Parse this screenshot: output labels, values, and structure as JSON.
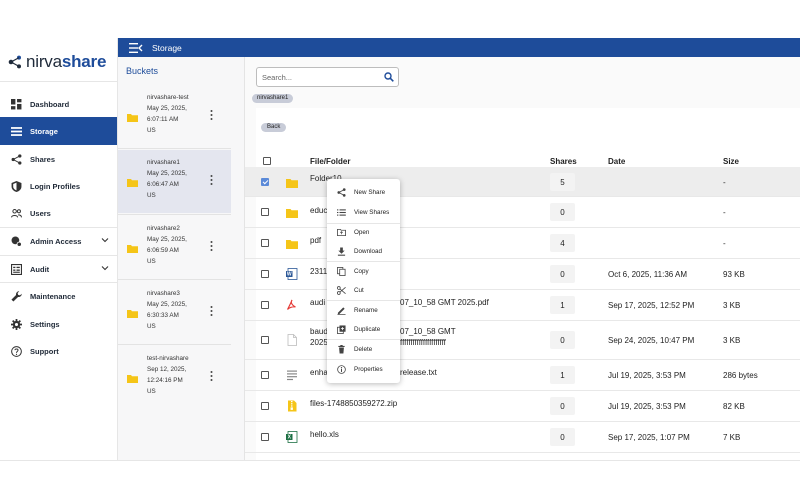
{
  "brand": {
    "logo_prefix": "nirva",
    "logo_suffix": "share"
  },
  "sidebar": {
    "items": [
      {
        "label": "Dashboard",
        "icon": "dashboard-icon"
      },
      {
        "label": "Storage",
        "icon": "storage-icon",
        "active": true
      },
      {
        "label": "Shares",
        "icon": "share-icon"
      },
      {
        "label": "Login Profiles",
        "icon": "shield-icon"
      },
      {
        "label": "Users",
        "icon": "users-icon"
      },
      {
        "label": "Admin Access",
        "icon": "admin-icon",
        "expandable": true
      },
      {
        "label": "Audit",
        "icon": "audit-icon",
        "expandable": true
      },
      {
        "label": "Maintenance",
        "icon": "wrench-icon"
      },
      {
        "label": "Settings",
        "icon": "gear-icon"
      },
      {
        "label": "Support",
        "icon": "help-icon"
      }
    ]
  },
  "topbar": {
    "title": "Storage"
  },
  "buckets": {
    "title": "Buckets",
    "items": [
      {
        "name": "nirvashare-test",
        "date": "May 25, 2025,",
        "time": "6:07:11 AM",
        "region": "US"
      },
      {
        "name": "nirvashare1",
        "date": "May 25, 2025,",
        "time": "6:06:47 AM",
        "region": "US",
        "selected": true
      },
      {
        "name": "nirvashare2",
        "date": "May 25, 2025,",
        "time": "6:06:59 AM",
        "region": "US"
      },
      {
        "name": "nirvashare3",
        "date": "May 25, 2025,",
        "time": "6:30:33 AM",
        "region": "US"
      },
      {
        "name": "test-nirvashare",
        "date": "Sep 12, 2025,",
        "time": "12:24:16 PM",
        "region": "US"
      }
    ]
  },
  "search": {
    "placeholder": "Search..."
  },
  "breadcrumb": {
    "chip": "nirvashare1"
  },
  "back_label": "Back",
  "table": {
    "headers": {
      "name": "File/Folder",
      "shares": "Shares",
      "date": "Date",
      "size": "Size"
    },
    "rows": [
      {
        "name": "Folder10",
        "type": "folder",
        "shares": "5",
        "date": "",
        "size": "-",
        "checked": true,
        "highlight": true
      },
      {
        "name": "educ",
        "type": "folder",
        "shares": "0",
        "date": "",
        "size": "-"
      },
      {
        "name": "pdf",
        "type": "folder",
        "shares": "4",
        "date": "",
        "size": "-"
      },
      {
        "name": "2311",
        "type": "word",
        "shares": "0",
        "date": "Oct 6, 2025, 11:36 AM",
        "size": "93 KB"
      },
      {
        "name": "audi",
        "name_tail": "07_10_58 GMT 2025.pdf",
        "type": "pdf",
        "shares": "1",
        "date": "Sep 17, 2025, 12:52 PM",
        "size": "3 KB"
      },
      {
        "name": "baud",
        "name_tail": "07_10_58 GMT",
        "name2": "2025",
        "name2_tail": "ffffffffffffffffffffff",
        "type": "blank",
        "shares": "0",
        "date": "Sep 24, 2025, 10:47 PM",
        "size": "3 KB"
      },
      {
        "name": "enha",
        "name_tail": "release.txt",
        "type": "text",
        "shares": "1",
        "date": "Jul 19, 2025, 3:53 PM",
        "size": "286 bytes"
      },
      {
        "name": "files-1748850359272.zip",
        "type": "zip",
        "shares": "0",
        "date": "Jul 19, 2025, 3:53 PM",
        "size": "82 KB"
      },
      {
        "name": "hello.xls",
        "type": "excel",
        "shares": "0",
        "date": "Sep 17, 2025, 1:07 PM",
        "size": "7 KB"
      }
    ]
  },
  "context_menu": {
    "items": [
      {
        "label": "New Share",
        "icon": "share-icon"
      },
      {
        "label": "View Shares",
        "icon": "list-icon"
      },
      {
        "label": "Open",
        "icon": "open-folder-icon"
      },
      {
        "label": "Download",
        "icon": "download-icon"
      },
      {
        "label": "Copy",
        "icon": "copy-icon"
      },
      {
        "label": "Cut",
        "icon": "scissors-icon"
      },
      {
        "label": "Rename",
        "icon": "pencil-icon"
      },
      {
        "label": "Duplicate",
        "icon": "duplicate-icon"
      },
      {
        "label": "Delete",
        "icon": "trash-icon"
      },
      {
        "label": "Properties",
        "icon": "info-icon"
      }
    ]
  },
  "colors": {
    "brand": "#1e4c9a",
    "folder": "#f5c518",
    "pdf": "#e53935",
    "word": "#2b5797",
    "excel": "#1e7145",
    "zip": "#e0a800"
  }
}
